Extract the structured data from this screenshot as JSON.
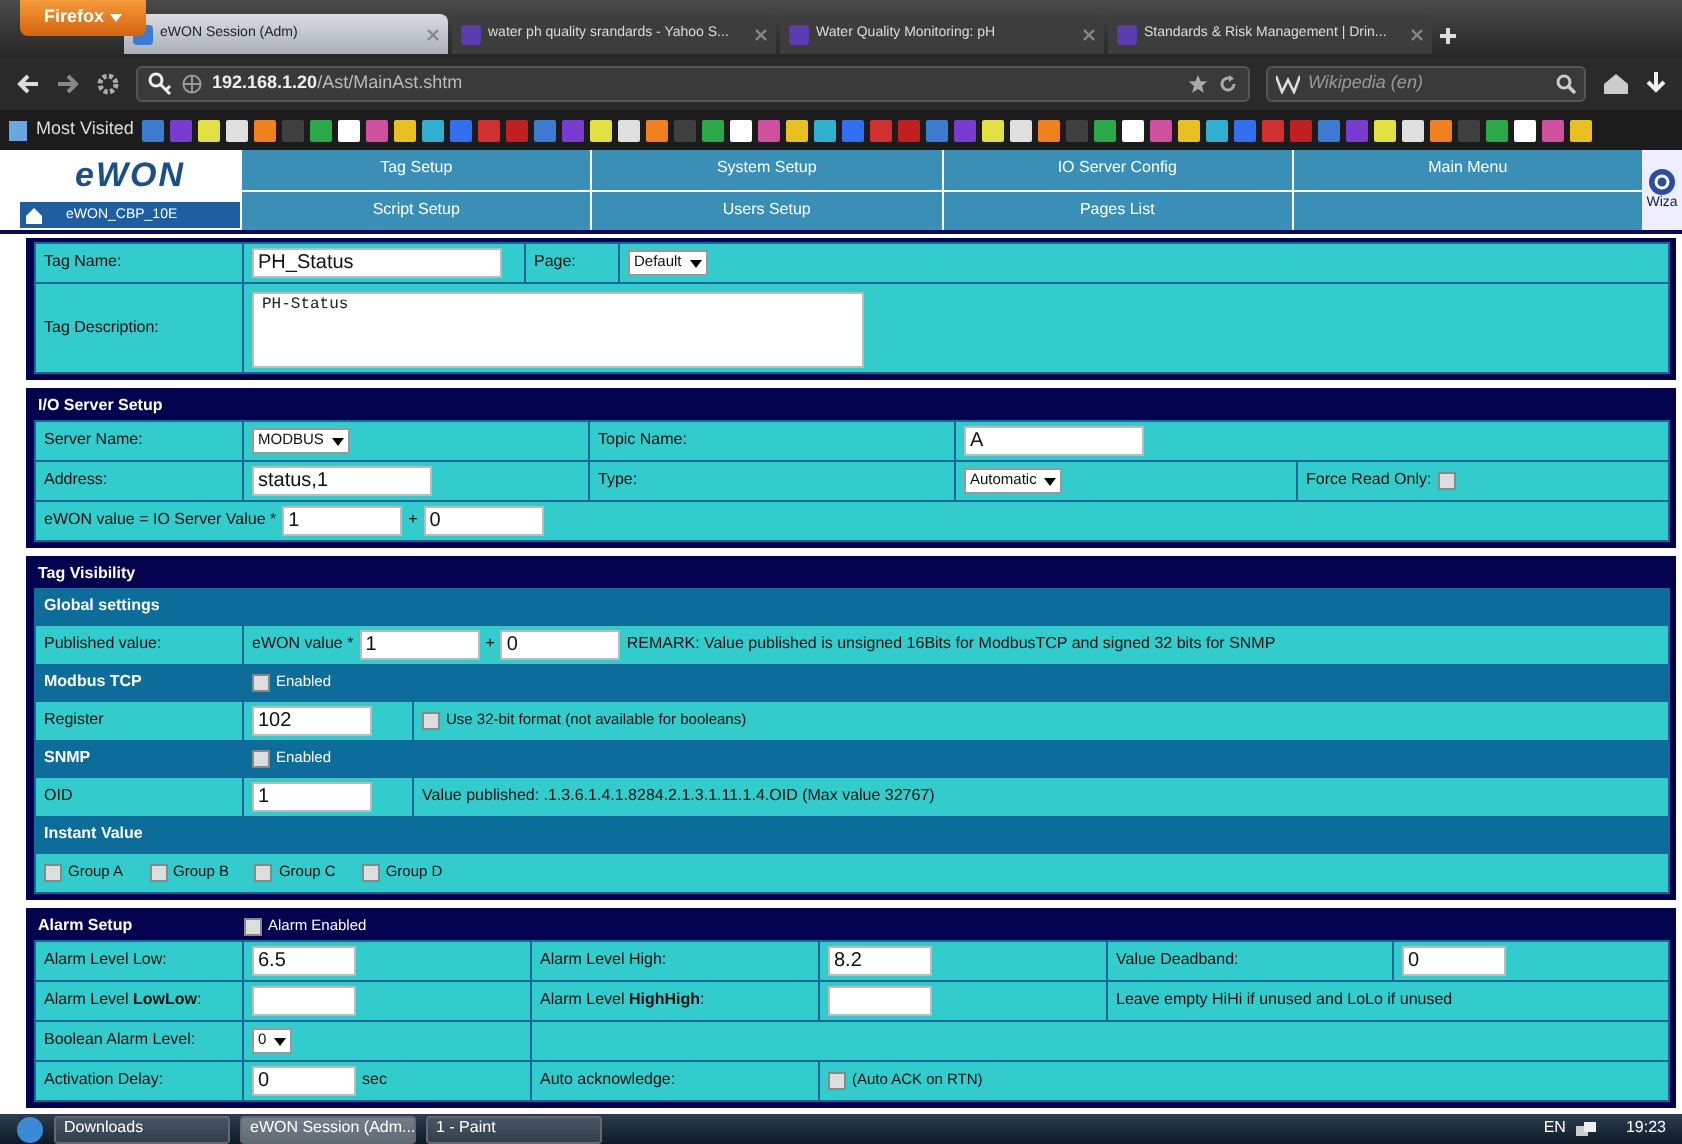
{
  "browser": {
    "menu_button": "Firefox",
    "tabs": [
      {
        "title": "eWON Session (Adm)",
        "selected": true
      },
      {
        "title": "water ph quality srandards - Yahoo S...",
        "selected": false
      },
      {
        "title": "Water Quality Monitoring: pH",
        "selected": false
      },
      {
        "title": "Standards & Risk Management | Drin...",
        "selected": false
      }
    ],
    "url": "**192.168.1.20**/Ast/MainAst.shtm",
    "search": {
      "placeholder": "Wikipedia (en)"
    },
    "bookmarks_label": "Most Visited"
  },
  "ewon": {
    "logo": "eWON",
    "device": "eWON_CBP_10E",
    "menu": [
      {
        "label": "Tag Setup"
      },
      {
        "label": "System Setup"
      },
      {
        "label": "IO Server Config"
      },
      {
        "label": "Main Menu"
      },
      {
        "label": "Script Setup"
      },
      {
        "label": "Users Setup"
      },
      {
        "label": "Pages List"
      }
    ],
    "wizard": "Wiza"
  },
  "sections": [
    {
      "rows": [
        {
          "kind": "field",
          "cells": [
            {
              "items": [
                {
                  "kind": "text",
                  "text": "Tag Name:"
                }
              ]
            },
            {
              "items": [
                {
                  "kind": "input",
                  "value": "PH_Status"
                }
              ]
            },
            {
              "items": [
                {
                  "kind": "text",
                  "text": "Page:"
                }
              ]
            },
            {
              "items": [
                {
                  "kind": "select",
                  "value": "Default"
                }
              ]
            }
          ]
        },
        {
          "kind": "field",
          "cells": [
            {
              "items": [
                {
                  "kind": "text",
                  "text": "Tag Description:"
                }
              ]
            },
            {
              "items": [
                {
                  "kind": "textarea",
                  "value": "PH-Status"
                }
              ]
            }
          ]
        }
      ]
    },
    {
      "title": "I/O Server Setup",
      "rows": [
        {
          "kind": "field",
          "cells": [
            {
              "items": [
                {
                  "kind": "text",
                  "text": "Server Name:"
                }
              ]
            },
            {
              "items": [
                {
                  "kind": "select",
                  "value": "MODBUS"
                }
              ]
            },
            {
              "items": [
                {
                  "kind": "text",
                  "text": "Topic Name:"
                }
              ]
            },
            {
              "items": [
                {
                  "kind": "input",
                  "value": "A"
                }
              ]
            }
          ]
        },
        {
          "kind": "field",
          "cells": [
            {
              "items": [
                {
                  "kind": "text",
                  "text": "Address:"
                }
              ]
            },
            {
              "items": [
                {
                  "kind": "input",
                  "value": "status,1"
                }
              ]
            },
            {
              "items": [
                {
                  "kind": "text",
                  "text": "Type:"
                }
              ]
            },
            {
              "items": [
                {
                  "kind": "select",
                  "value": "Automatic"
                }
              ]
            },
            {
              "items": [
                {
                  "kind": "text",
                  "text": "Force Read Only:"
                },
                {
                  "kind": "check",
                  "checked": false
                }
              ]
            }
          ]
        },
        {
          "kind": "field",
          "cells": [
            {
              "items": [
                {
                  "kind": "text",
                  "text": "eWON value = IO Server Value *"
                },
                {
                  "kind": "input",
                  "value": "1"
                },
                {
                  "kind": "text",
                  "text": "+"
                },
                {
                  "kind": "input",
                  "value": "0"
                }
              ]
            }
          ]
        }
      ]
    },
    {
      "title": "Tag Visibility",
      "rows": [
        {
          "kind": "subhead",
          "cells": [
            {
              "items": [
                {
                  "kind": "text",
                  "text": "Global settings"
                }
              ]
            }
          ]
        },
        {
          "kind": "field",
          "cells": [
            {
              "items": [
                {
                  "kind": "text",
                  "text": "Published value:"
                }
              ]
            },
            {
              "items": [
                {
                  "kind": "text",
                  "text": "eWON value *"
                },
                {
                  "kind": "input",
                  "value": "1"
                },
                {
                  "kind": "text",
                  "text": "+"
                },
                {
                  "kind": "input",
                  "value": "0"
                },
                {
                  "kind": "text",
                  "text": "REMARK: Value published is unsigned 16Bits for ModbusTCP and signed 32 bits for SNMP"
                }
              ]
            }
          ]
        },
        {
          "kind": "subhead",
          "cells": [
            {
              "items": [
                {
                  "kind": "text",
                  "text": "Modbus TCP"
                }
              ]
            },
            {
              "items": [
                {
                  "kind": "check",
                  "checked": false,
                  "label": "Enabled"
                }
              ]
            }
          ]
        },
        {
          "kind": "field",
          "cells": [
            {
              "items": [
                {
                  "kind": "text",
                  "text": "Register"
                }
              ]
            },
            {
              "items": [
                {
                  "kind": "input",
                  "value": "102"
                }
              ]
            },
            {
              "items": [
                {
                  "kind": "check",
                  "checked": false,
                  "label": "Use 32-bit format (not available for booleans)"
                }
              ]
            }
          ]
        },
        {
          "kind": "subhead",
          "cells": [
            {
              "items": [
                {
                  "kind": "text",
                  "text": "SNMP"
                }
              ]
            },
            {
              "items": [
                {
                  "kind": "check",
                  "checked": false,
                  "label": "Enabled"
                }
              ]
            }
          ]
        },
        {
          "kind": "field",
          "cells": [
            {
              "items": [
                {
                  "kind": "text",
                  "text": "OID"
                }
              ]
            },
            {
              "items": [
                {
                  "kind": "input",
                  "value": "1"
                }
              ]
            },
            {
              "items": [
                {
                  "kind": "text",
                  "text": "Value published: .1.3.6.1.4.1.8284.2.1.3.1.11.1.4.OID (Max value 32767)"
                }
              ]
            }
          ]
        },
        {
          "kind": "subhead",
          "cells": [
            {
              "items": [
                {
                  "kind": "text",
                  "text": "Instant Value"
                }
              ]
            }
          ]
        },
        {
          "kind": "field",
          "cells": [
            {
              "items": [
                {
                  "kind": "check",
                  "checked": false,
                  "label": "Group A"
                },
                {
                  "kind": "check",
                  "checked": false,
                  "label": "Group B"
                },
                {
                  "kind": "check",
                  "checked": false,
                  "label": "Group C"
                },
                {
                  "kind": "check",
                  "checked": false,
                  "label": "Group D"
                }
              ]
            }
          ]
        }
      ]
    },
    {
      "title": "Alarm Setup",
      "header_items": [
        {
          "kind": "check",
          "checked": false,
          "label": "Alarm Enabled"
        }
      ],
      "rows": [
        {
          "kind": "field",
          "cells": [
            {
              "items": [
                {
                  "kind": "text",
                  "text": "Alarm Level Low:"
                }
              ]
            },
            {
              "items": [
                {
                  "kind": "input",
                  "value": "6.5"
                }
              ]
            },
            {
              "items": [
                {
                  "kind": "text",
                  "text": "Alarm Level High:"
                }
              ]
            },
            {
              "items": [
                {
                  "kind": "input",
                  "value": "8.2"
                }
              ]
            },
            {
              "items": [
                {
                  "kind": "text",
                  "text": "Value Deadband:"
                }
              ]
            },
            {
              "items": [
                {
                  "kind": "input",
                  "value": "0"
                }
              ]
            }
          ]
        },
        {
          "kind": "field",
          "cells": [
            {
              "items": [
                {
                  "kind": "text",
                  "text": "Alarm Level **LowLow**:"
                }
              ]
            },
            {
              "items": [
                {
                  "kind": "input",
                  "value": ""
                }
              ]
            },
            {
              "items": [
                {
                  "kind": "text",
                  "text": "Alarm Level **HighHigh**:"
                }
              ]
            },
            {
              "items": [
                {
                  "kind": "input",
                  "value": ""
                }
              ]
            },
            {
              "items": [
                {
                  "kind": "text",
                  "text": "Leave empty HiHi if unused and LoLo if unused"
                }
              ]
            }
          ]
        },
        {
          "kind": "field",
          "cells": [
            {
              "items": [
                {
                  "kind": "text",
                  "text": "Boolean Alarm Level:"
                }
              ]
            },
            {
              "items": [
                {
                  "kind": "select",
                  "value": "0"
                }
              ]
            },
            {}
          ]
        },
        {
          "kind": "field",
          "cells": [
            {
              "items": [
                {
                  "kind": "text",
                  "text": "Activation Delay:"
                }
              ]
            },
            {
              "items": [
                {
                  "kind": "input",
                  "value": "0"
                },
                {
                  "kind": "text",
                  "text": "sec"
                }
              ]
            },
            {
              "items": [
                {
                  "kind": "text",
                  "text": "Auto acknowledge:"
                }
              ]
            },
            {
              "items": [
                {
                  "kind": "check",
                  "checked": false,
                  "label": "(Auto ACK on RTN)"
                }
              ]
            }
          ]
        }
      ]
    }
  ],
  "taskbar": {
    "items": [
      {
        "label": "Downloads",
        "selected": false
      },
      {
        "label": "eWON Session (Adm...",
        "selected": true
      },
      {
        "label": "1 - Paint",
        "selected": false
      }
    ],
    "language": "EN",
    "clock": "19:23"
  }
}
